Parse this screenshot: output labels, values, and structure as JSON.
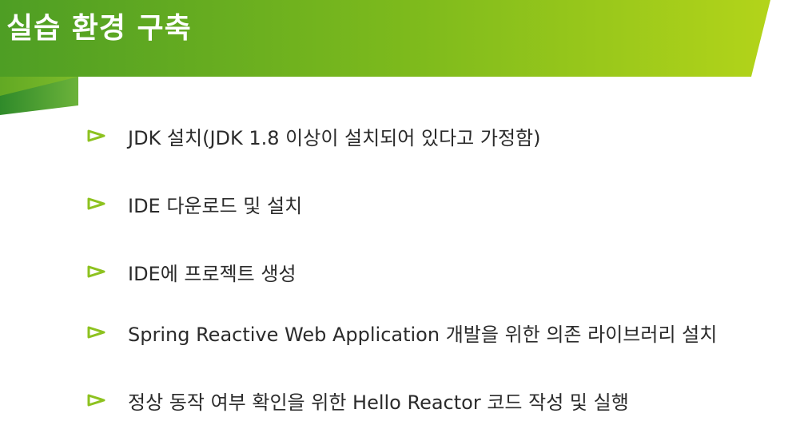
{
  "slide": {
    "title": "실습 환경 구축",
    "bullets": [
      "JDK 설치(JDK 1.8 이상이 설치되어 있다고 가정함)",
      "IDE 다운로드 및 설치",
      "IDE에 프로젝트 생성",
      "Spring Reactive Web Application 개발을 위한 의존 라이브러리 설치",
      "정상 동작 여부 확인을 위한 Hello Reactor 코드 작성 및 실행"
    ],
    "bullet_icon": "triangle-bullet-icon"
  },
  "colors": {
    "header_dark": "#4e9e24",
    "header_light": "#a6cf18",
    "accent_green": "#8dc21f",
    "text": "#2b2b2b",
    "title_text": "#ffffff"
  }
}
